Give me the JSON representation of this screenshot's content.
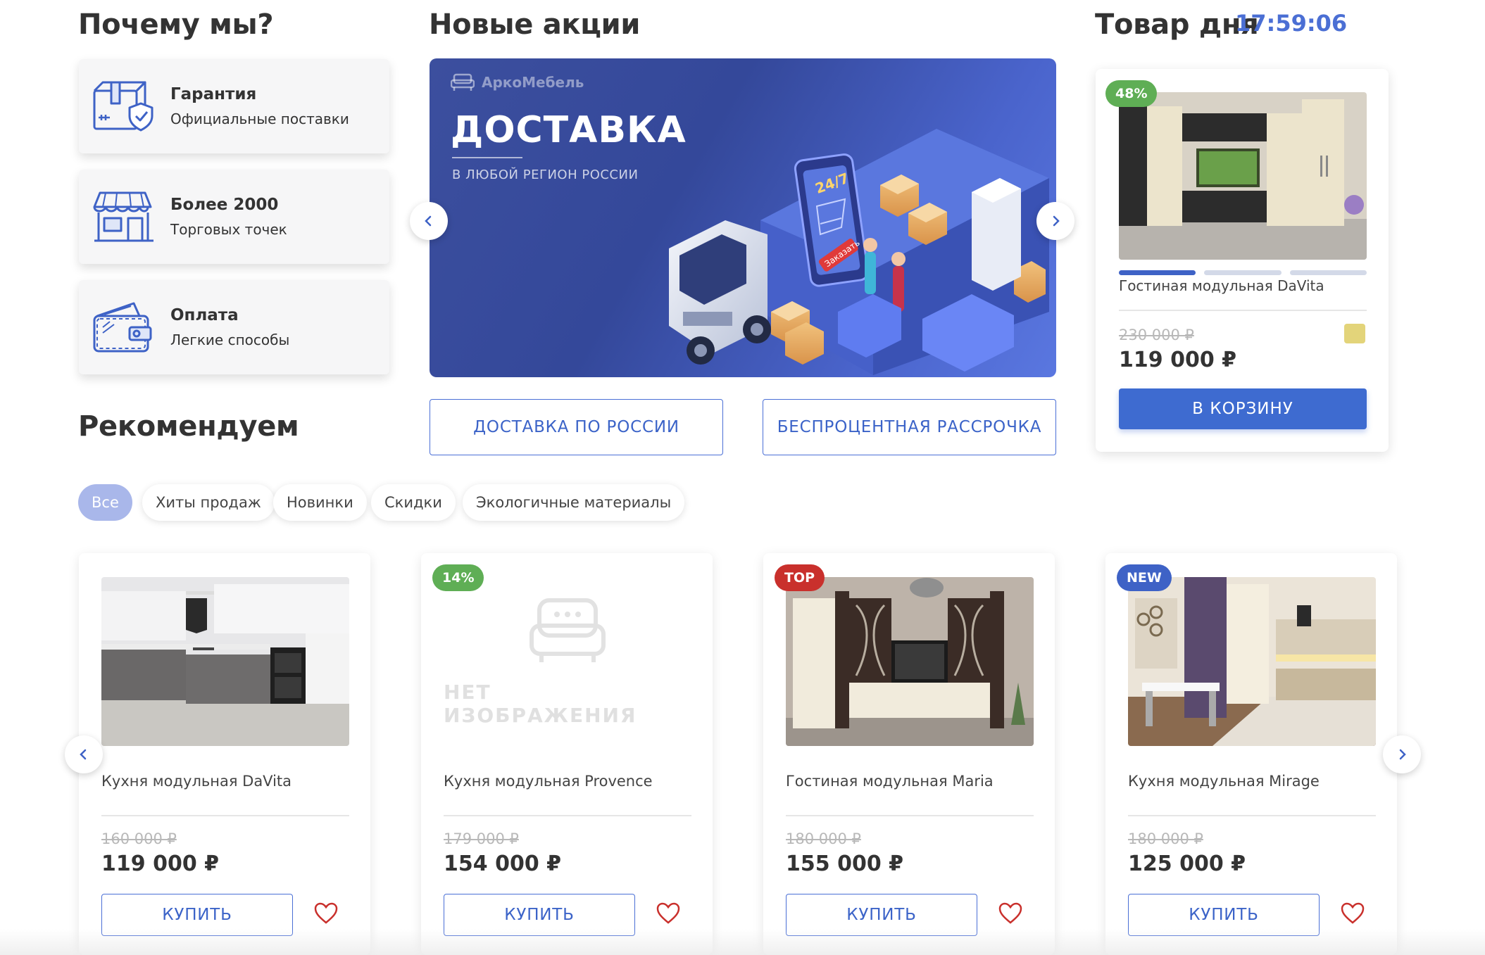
{
  "why": {
    "title": "Почему мы?",
    "items": [
      {
        "title": "Гарантия",
        "subtitle": "Официальные поставки",
        "icon": "box-shield-icon"
      },
      {
        "title": "Более 2000",
        "subtitle": "Торговых точек",
        "icon": "store-icon"
      },
      {
        "title": "Оплата",
        "subtitle": "Легкие способы",
        "icon": "wallet-icon"
      }
    ]
  },
  "promo": {
    "title": "Новые акции",
    "banner": {
      "brand": "АркоМебель",
      "headline": "ДОСТАВКА",
      "subline": "В ЛЮБОЙ РЕГИОН РОССИИ",
      "phone_text": "24/7",
      "order_text": "Заказать"
    },
    "buttons": [
      "ДОСТАВКА ПО РОССИИ",
      "БЕСПРОЦЕНТНАЯ РАССРОЧКА"
    ]
  },
  "deal": {
    "title": "Товар дня",
    "timer": "17:59:06",
    "badge": "48%",
    "name": "Гостиная модульная DaVita",
    "old_price": "230 000 ₽",
    "price": "119 000 ₽",
    "cart_label": "В КОРЗИНУ",
    "swatch_color": "#e3d47a"
  },
  "recommend": {
    "title": "Рекомендуем",
    "filters": [
      "Все",
      "Хиты продаж",
      "Новинки",
      "Скидки",
      "Экологичные материалы"
    ],
    "active_filter": "Все",
    "no_image_text": "НЕТ ИЗОБРАЖЕНИЯ",
    "products": [
      {
        "name": "Кухня модульная DaVita",
        "old_price": "160 000 ₽",
        "price": "119 000 ₽",
        "badge": "",
        "buy_label": "КУПИТЬ"
      },
      {
        "name": "Кухня модульная Provence",
        "old_price": "179 000 ₽",
        "price": "154 000 ₽",
        "badge": "14%",
        "buy_label": "КУПИТЬ"
      },
      {
        "name": "Гостиная модульная Maria",
        "old_price": "180 000 ₽",
        "price": "155 000 ₽",
        "badge": "TOP",
        "buy_label": "КУПИТЬ"
      },
      {
        "name": "Кухня модульная Mirage",
        "old_price": "180 000 ₽",
        "price": "125 000 ₽",
        "badge": "NEW",
        "buy_label": "КУПИТЬ"
      }
    ]
  },
  "colors": {
    "accent": "#3e6bd0",
    "discount_badge": "#5fae55",
    "top_badge": "#c9302c",
    "new_badge": "#3e62c6",
    "heart": "#c9302c"
  }
}
